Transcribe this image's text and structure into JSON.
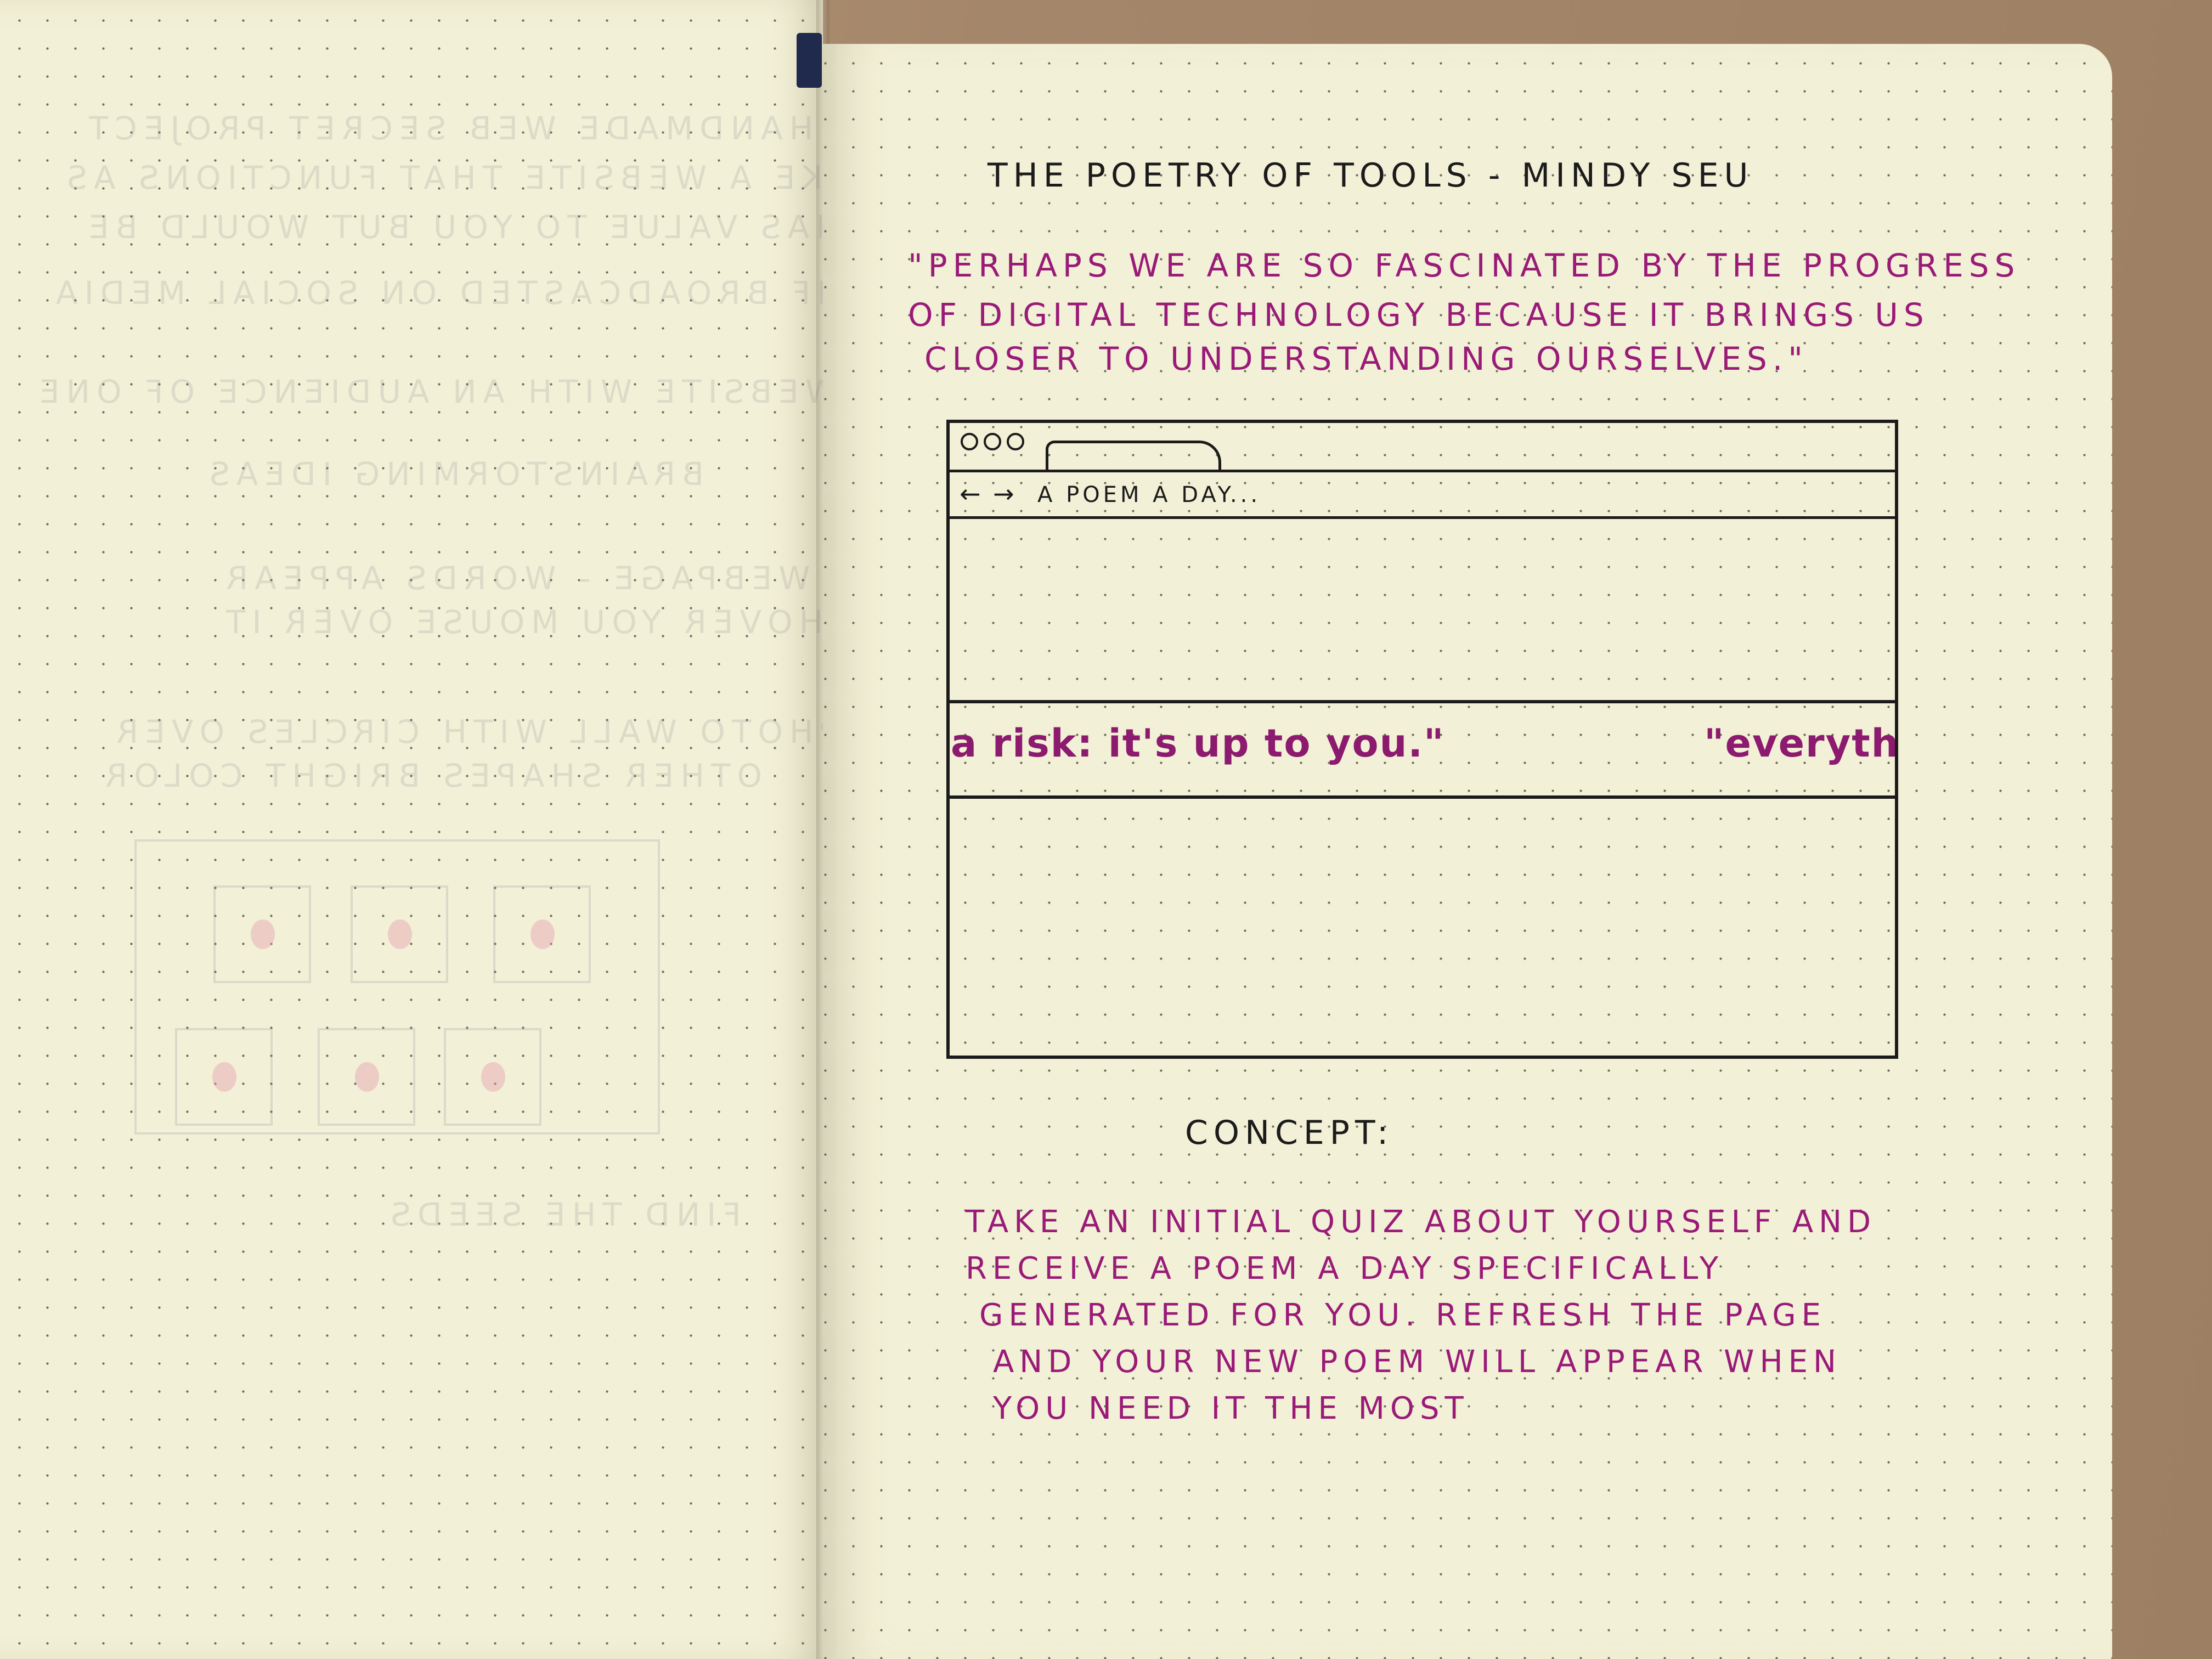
{
  "notebook": {
    "title": "THE POETRY OF TOOLS - MINDY SEU",
    "quote_lines": [
      "\"PERHAPS WE ARE SO FASCINATED BY THE PROGRESS",
      "OF DIGITAL TECHNOLOGY BECAUSE IT BRINGS US",
      "CLOSER TO UNDERSTANDING OURSELVES.\""
    ],
    "browser_sketch": {
      "url": "A POEM A DAY...",
      "nav_arrows": "← →",
      "scroll_text_left": "a risk: it's up to you.\"",
      "scroll_text_right": "\"everyth"
    },
    "concept_title": "CONCEPT:",
    "concept_lines": [
      "TAKE AN INITIAL QUIZ ABOUT YOURSELF AND",
      "RECEIVE A POEM A DAY SPECIFICALLY",
      "GENERATED FOR YOU. REFRESH THE PAGE",
      "AND YOUR NEW POEM WILL APPEAR WHEN",
      "YOU NEED IT THE MOST"
    ]
  },
  "colors": {
    "ink_black": "#1b1b1b",
    "ink_magenta": "#9a1a78",
    "paper": "#f2f0d6"
  }
}
